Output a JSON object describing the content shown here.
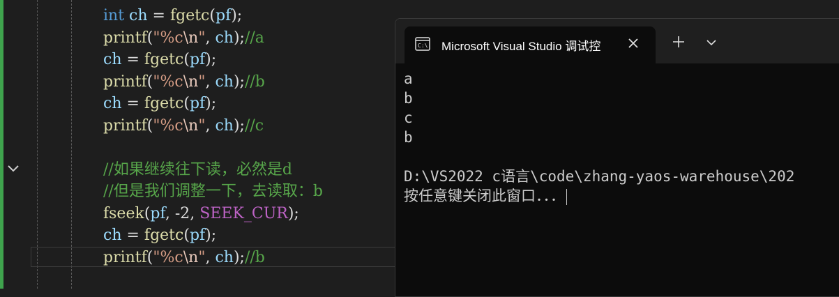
{
  "editor": {
    "lines": [
      {
        "t": [
          {
            "c": "kw",
            "v": "int"
          },
          {
            "c": "pl",
            "v": " "
          },
          {
            "c": "var",
            "v": "ch"
          },
          {
            "c": "pl",
            "v": " = "
          },
          {
            "c": "fn",
            "v": "fgetc"
          },
          {
            "c": "pl",
            "v": "("
          },
          {
            "c": "var",
            "v": "pf"
          },
          {
            "c": "pl",
            "v": ");"
          }
        ]
      },
      {
        "t": [
          {
            "c": "fn",
            "v": "printf"
          },
          {
            "c": "pl",
            "v": "("
          },
          {
            "c": "str",
            "v": "\"%c"
          },
          {
            "c": "esc",
            "v": "\\n"
          },
          {
            "c": "str",
            "v": "\""
          },
          {
            "c": "pl",
            "v": ", "
          },
          {
            "c": "var",
            "v": "ch"
          },
          {
            "c": "pl",
            "v": ");"
          },
          {
            "c": "cmt",
            "v": "//a"
          }
        ]
      },
      {
        "t": [
          {
            "c": "var",
            "v": "ch"
          },
          {
            "c": "pl",
            "v": " = "
          },
          {
            "c": "fn",
            "v": "fgetc"
          },
          {
            "c": "pl",
            "v": "("
          },
          {
            "c": "var",
            "v": "pf"
          },
          {
            "c": "pl",
            "v": ");"
          }
        ]
      },
      {
        "t": [
          {
            "c": "fn",
            "v": "printf"
          },
          {
            "c": "pl",
            "v": "("
          },
          {
            "c": "str",
            "v": "\"%c"
          },
          {
            "c": "esc",
            "v": "\\n"
          },
          {
            "c": "str",
            "v": "\""
          },
          {
            "c": "pl",
            "v": ", "
          },
          {
            "c": "var",
            "v": "ch"
          },
          {
            "c": "pl",
            "v": ");"
          },
          {
            "c": "cmt",
            "v": "//b"
          }
        ]
      },
      {
        "t": [
          {
            "c": "var",
            "v": "ch"
          },
          {
            "c": "pl",
            "v": " = "
          },
          {
            "c": "fn",
            "v": "fgetc"
          },
          {
            "c": "pl",
            "v": "("
          },
          {
            "c": "var",
            "v": "pf"
          },
          {
            "c": "pl",
            "v": ");"
          }
        ]
      },
      {
        "t": [
          {
            "c": "fn",
            "v": "printf"
          },
          {
            "c": "pl",
            "v": "("
          },
          {
            "c": "str",
            "v": "\"%c"
          },
          {
            "c": "esc",
            "v": "\\n"
          },
          {
            "c": "str",
            "v": "\""
          },
          {
            "c": "pl",
            "v": ", "
          },
          {
            "c": "var",
            "v": "ch"
          },
          {
            "c": "pl",
            "v": ");"
          },
          {
            "c": "cmt",
            "v": "//c"
          }
        ]
      },
      {
        "t": []
      },
      {
        "t": [
          {
            "c": "cmt",
            "v": "//如果继续往下读，必然是d"
          }
        ]
      },
      {
        "t": [
          {
            "c": "cmt",
            "v": "//但是我们调整一下，去读取：b"
          }
        ]
      },
      {
        "t": [
          {
            "c": "fn",
            "v": "fseek"
          },
          {
            "c": "pl",
            "v": "("
          },
          {
            "c": "var",
            "v": "pf"
          },
          {
            "c": "pl",
            "v": ", -2, "
          },
          {
            "c": "mac",
            "v": "SEEK_CUR"
          },
          {
            "c": "pl",
            "v": ");"
          }
        ]
      },
      {
        "t": [
          {
            "c": "var",
            "v": "ch"
          },
          {
            "c": "pl",
            "v": " = "
          },
          {
            "c": "fn",
            "v": "fgetc"
          },
          {
            "c": "pl",
            "v": "("
          },
          {
            "c": "var",
            "v": "pf"
          },
          {
            "c": "pl",
            "v": ");"
          }
        ]
      },
      {
        "t": [
          {
            "c": "fn",
            "v": "printf"
          },
          {
            "c": "pl",
            "v": "("
          },
          {
            "c": "str",
            "v": "\"%c"
          },
          {
            "c": "esc",
            "v": "\\n"
          },
          {
            "c": "str",
            "v": "\""
          },
          {
            "c": "pl",
            "v": ", "
          },
          {
            "c": "var",
            "v": "ch"
          },
          {
            "c": "pl",
            "v": ");"
          },
          {
            "c": "cmt",
            "v": "//b"
          }
        ]
      }
    ]
  },
  "console": {
    "tab_title": "Microsoft Visual Studio 调试控",
    "tab_icon": "terminal-icon",
    "output": [
      "a",
      "b",
      "c",
      "b"
    ],
    "path_line": "D:\\VS2022 c语言\\code\\zhang-yaos-warehouse\\202",
    "prompt_line": "按任意键关闭此窗口．．．"
  },
  "colors": {
    "editor_bg": "#1e1e1e",
    "console_bg": "#0c0c0c",
    "change_bar": "#3fa34d",
    "keyword": "#569cd6",
    "function": "#dcdcaa",
    "string": "#d69d85",
    "variable": "#9cdcfe",
    "comment": "#57a64a",
    "macro": "#bd63c5"
  }
}
